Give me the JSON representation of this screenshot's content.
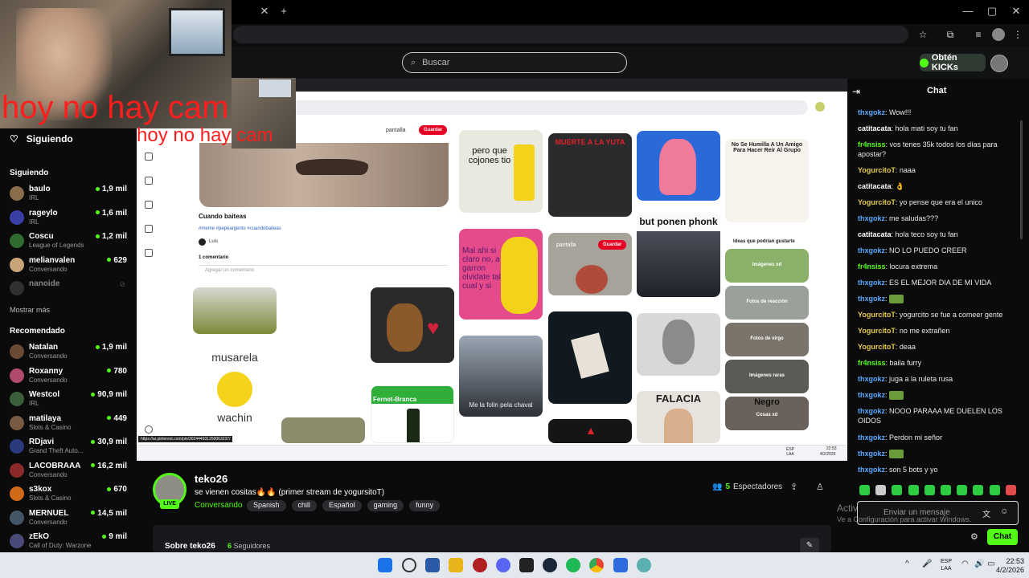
{
  "search": {
    "placeholder": "Buscar"
  },
  "header": {
    "kicks_label": "Obtén KICKs"
  },
  "sidebar": {
    "following_heading": "Siguiendo",
    "following_section": "Siguiendo",
    "following": [
      {
        "name": "baulo",
        "category": "IRL",
        "viewers": "1,9 mil",
        "color": "#8a6d4b"
      },
      {
        "name": "rageylo",
        "category": "IRL",
        "viewers": "1,6 mil",
        "color": "#3a3fa5"
      },
      {
        "name": "Coscu",
        "category": "League of Legends",
        "viewers": "1,2 mil",
        "color": "#2f6b2f"
      },
      {
        "name": "melianvalen",
        "category": "Conversando",
        "viewers": "629",
        "color": "#c9a37a"
      },
      {
        "name": "nanoide",
        "category": "",
        "viewers": "",
        "color": "#555555"
      }
    ],
    "show_more": "Mostrar más",
    "recommended_heading": "Recomendado",
    "recommended": [
      {
        "name": "Natalan",
        "category": "Conversando",
        "viewers": "1,9 mil",
        "color": "#6b4a35"
      },
      {
        "name": "Roxanny",
        "category": "Conversando",
        "viewers": "780",
        "color": "#b04a6b"
      },
      {
        "name": "Westcol",
        "category": "IRL",
        "viewers": "90,9 mil",
        "color": "#3a5f3a"
      },
      {
        "name": "matilaya",
        "category": "Slots & Casino",
        "viewers": "449",
        "color": "#7a5a40"
      },
      {
        "name": "RDjavi",
        "category": "Grand Theft Auto...",
        "viewers": "30,9 mil",
        "color": "#2a3a7a"
      },
      {
        "name": "LACOBRAAA",
        "category": "Conversando",
        "viewers": "16,2 mil",
        "color": "#8a2a2a"
      },
      {
        "name": "s3kox",
        "category": "Slots & Casino",
        "viewers": "670",
        "color": "#d06a1a"
      },
      {
        "name": "MERNUEL",
        "category": "Conversando",
        "viewers": "14,5 mil",
        "color": "#445566"
      },
      {
        "name": "zEkO",
        "category": "Call of Duty: Warzone",
        "viewers": "9 mil",
        "color": "#4a4a7a"
      }
    ]
  },
  "overlay": {
    "cam_text": "hoy no hay cam"
  },
  "stream": {
    "pin_title": "Cuando baiteas",
    "pin_tags": "#meme #pepeargento #cuandobaiteas",
    "pin_user": "Luis",
    "pin_comments": "1 comentario",
    "pin_comment_placeholder": "Agregar un comentario",
    "board_label": "pantalla",
    "save_label": "Guardar",
    "ideas_label": "Ideas que podrían gustarte",
    "status_url": "https://ar.pinterest.com/pin/3024449312500632​37/",
    "tiles": {
      "t1": "pero que cojones tio",
      "t2": "MUERTE A LA YUTA",
      "t3": "but ponen phonk",
      "t4": "No Se Humilla A Un Amigo Para Hacer Reir Al Grupo",
      "t5": "Mal ahi si claro no, a garron olvidate tal cual y si",
      "t6": "musarela",
      "t7": "wachin",
      "t8": "Me la folin pela chaval",
      "t9": "Fernet-Branca",
      "t10": "FALACIA",
      "t11": "Negro",
      "side1": "Imágenes xd",
      "side2": "Fotos de reacción",
      "side3": "Fotos de virgo",
      "side4": "Imágenes raras",
      "side5": "Cosas xd"
    },
    "clock_time": "22:53",
    "clock_date": "4/2/2026",
    "lang": "ESP LAA"
  },
  "channel": {
    "name": "teko26",
    "title": "se vienen cositas🔥🔥 (primer stream de yogursitoT)",
    "category": "Conversando",
    "tags": [
      "Spanish",
      "chill",
      "Español",
      "gaming",
      "funny"
    ],
    "live": "LIVE",
    "viewers": "5",
    "viewers_label": "Espectadores",
    "about": "Sobre teko26",
    "followers": "6",
    "followers_label": "Seguidores"
  },
  "chat": {
    "title": "Chat",
    "messages": [
      {
        "user": "thxgokz",
        "text": "Wow!!!",
        "color": "#5aa9ff"
      },
      {
        "user": "catitacata",
        "text": "hola mati soy tu fan",
        "color": "#ffffff"
      },
      {
        "user": "fr4nsiss",
        "text": "vos tenes 35k todos los días para apostar?",
        "color": "#53fc18"
      },
      {
        "user": "YogurcitoT",
        "text": "naaa",
        "color": "#e6c84a"
      },
      {
        "user": "catitacata",
        "text": "👌",
        "color": "#ffffff"
      },
      {
        "user": "YogurcitoT",
        "text": "yo pense que era el unico",
        "color": "#e6c84a"
      },
      {
        "user": "thxgokz",
        "text": "me saludas???",
        "color": "#5aa9ff"
      },
      {
        "user": "catitacata",
        "text": "hola teco soy tu fan",
        "color": "#ffffff"
      },
      {
        "user": "thxgokz",
        "text": "NO LO PUEDO CREER",
        "color": "#5aa9ff"
      },
      {
        "user": "fr4nsiss",
        "text": "locura extrema",
        "color": "#53fc18"
      },
      {
        "user": "thxgokz",
        "text": "ES EL MEJOR DIA DE MI VIDA",
        "color": "#5aa9ff"
      },
      {
        "user": "thxgokz",
        "text": "",
        "color": "#5aa9ff"
      },
      {
        "user": "YogurcitoT",
        "text": "yogurcito se fue a comeer gente",
        "color": "#e6c84a"
      },
      {
        "user": "YogurcitoT",
        "text": "no me extrañen",
        "color": "#e6c84a"
      },
      {
        "user": "YogurcitoT",
        "text": "deaa",
        "color": "#e6c84a"
      },
      {
        "user": "fr4nsiss",
        "text": "baila furry",
        "color": "#53fc18"
      },
      {
        "user": "thxgokz",
        "text": "juga a la ruleta rusa",
        "color": "#5aa9ff"
      },
      {
        "user": "thxgokz",
        "text": "",
        "color": "#5aa9ff"
      },
      {
        "user": "thxgokz",
        "text": "NOOO PARAAA ME DUELEN LOS OIDOS",
        "color": "#5aa9ff"
      },
      {
        "user": "thxgokz",
        "text": "Perdon mi señor",
        "color": "#5aa9ff"
      },
      {
        "user": "thxgokz",
        "text": "",
        "color": "#5aa9ff"
      },
      {
        "user": "thxgokz",
        "text": "son 5 bots y yo",
        "color": "#5aa9ff"
      }
    ],
    "input_placeholder": "Enviar un mensaje",
    "send_label": "Chat"
  },
  "windows": {
    "activate_title": "Activar Windows",
    "activate_sub": "Ve a Configuración para activar Windows.",
    "lang": "ESP LAA",
    "time": "22:53",
    "date": "4/2/2026"
  }
}
